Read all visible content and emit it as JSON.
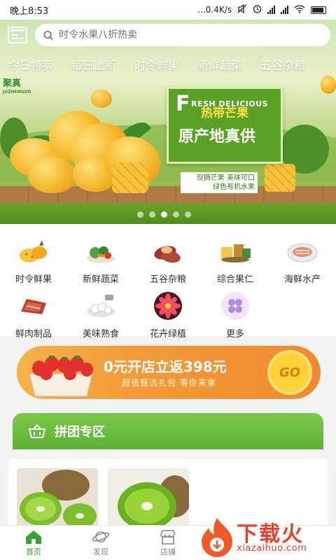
{
  "status_bar": {
    "time": "晚上8:53",
    "network_speed": "...0.4K/s",
    "battery_icon": "battery-icon"
  },
  "search": {
    "placeholder": "时令水果八折热卖"
  },
  "category_tabs": [
    "今日特卖",
    "每日上新",
    "时令鲜果",
    "新鲜蔬菜",
    "五谷杂粮"
  ],
  "banner": {
    "brand_name": "聚真",
    "brand_sub": "JUZHENGUO",
    "headline_letter": "F",
    "headline_rest": "RESH DELICIOUS",
    "title": "热带芒果",
    "subtitle": "原产地真供",
    "tag_line1": "现摘芒果  美味可口",
    "tag_line2": "绿色有机水果",
    "active_dot": 2,
    "dot_count": 5
  },
  "grid": [
    {
      "label": "时令鲜果",
      "icon": "fruit-icon"
    },
    {
      "label": "新鲜蔬菜",
      "icon": "vegetable-icon"
    },
    {
      "label": "五谷杂粮",
      "icon": "grain-icon"
    },
    {
      "label": "综合果仁",
      "icon": "nuts-icon"
    },
    {
      "label": "海鲜水产",
      "icon": "seafood-icon"
    },
    {
      "label": "鲜肉制品",
      "icon": "meat-icon"
    },
    {
      "label": "美味熟食",
      "icon": "cooked-food-icon"
    },
    {
      "label": "花卉绿植",
      "icon": "flower-icon"
    },
    {
      "label": "更多",
      "icon": "more-icon"
    }
  ],
  "promo": {
    "main": "0元开店立返398元",
    "sub": "超值甄选礼包 等你来拿",
    "go": "GO"
  },
  "group_buy": {
    "title": "拼团专区"
  },
  "bottom_nav": [
    {
      "label": "首页",
      "icon": "home-icon",
      "active": true
    },
    {
      "label": "发现",
      "icon": "planet-icon",
      "active": false
    },
    {
      "label": "店铺",
      "icon": "store-icon",
      "active": false
    }
  ],
  "watermark": {
    "text": "下载火",
    "url": "xiazaihuo.com"
  },
  "colors": {
    "accent": "#3aa03a",
    "promo": "#f39a3a",
    "header_green": "#5cb032"
  }
}
